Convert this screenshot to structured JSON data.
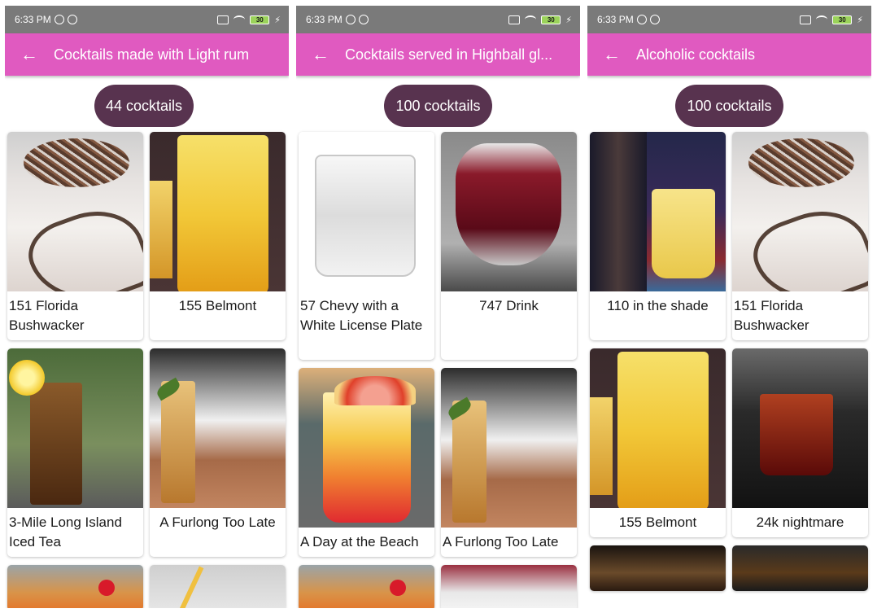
{
  "status_bar": {
    "time": "6:33 PM",
    "battery": "30"
  },
  "screens": [
    {
      "title": "Cocktails made with Light rum",
      "count": "44 cocktails",
      "cards": [
        {
          "name": "151 Florida Bushwacker"
        },
        {
          "name": "155 Belmont"
        },
        {
          "name": "3-Mile Long Island Iced Tea"
        },
        {
          "name": "A Furlong Too Late"
        }
      ]
    },
    {
      "title": "Cocktails served in Highball gl...",
      "count": "100 cocktails",
      "cards": [
        {
          "name": "57 Chevy with a White License Plate"
        },
        {
          "name": "747 Drink"
        },
        {
          "name": "A Day at the Beach"
        },
        {
          "name": "A Furlong Too Late"
        }
      ]
    },
    {
      "title": "Alcoholic cocktails",
      "count": "100 cocktails",
      "cards": [
        {
          "name": "110 in the shade"
        },
        {
          "name": "151 Florida Bushwacker"
        },
        {
          "name": "155 Belmont"
        },
        {
          "name": "24k nightmare"
        }
      ]
    }
  ],
  "colors": {
    "app_bar": "#e05ac0",
    "status_bar": "#7a7a7a",
    "count_pill": "#58334f"
  },
  "icons": {
    "back": "arrow-back-icon"
  }
}
